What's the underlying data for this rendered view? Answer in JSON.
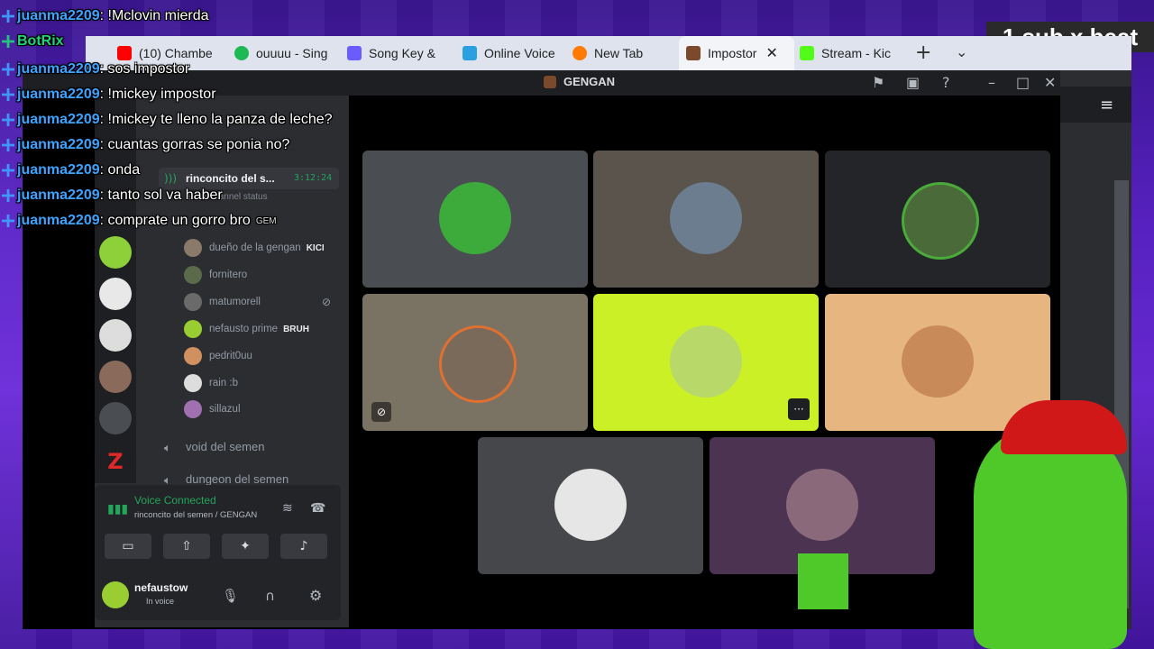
{
  "browser": {
    "tabs": [
      {
        "label": "(10) Chambe",
        "icon": "youtube-icon",
        "color": "#ff0000"
      },
      {
        "label": "ouuuu - Sing",
        "icon": "spotify-icon",
        "color": "#1db954"
      },
      {
        "label": "Song Key &",
        "icon": "tunebat-icon",
        "color": "#6b5cff"
      },
      {
        "label": "Online Voice",
        "icon": "voice-icon",
        "color": "#2aa0e0"
      },
      {
        "label": "New Tab",
        "icon": "firefox-icon",
        "color": "#ff7a00"
      },
      {
        "label": "Impostor",
        "icon": "impostor-icon",
        "color": "#7a4a2a"
      },
      {
        "label": "Stream - Kic",
        "icon": "kick-icon",
        "color": "#53fc18"
      }
    ],
    "new_tab": "+",
    "tab_menu": "⌄",
    "close": "✕"
  },
  "discord": {
    "window_title": "GENGAN",
    "voice_channel": {
      "name": "rinconcito del s...",
      "timer": "3:12:24",
      "status": "Set a channel status"
    },
    "members": [
      {
        "name": "dueño de la gengan",
        "badge": "KICI",
        "color": "#8a7a6a"
      },
      {
        "name": "fornitero",
        "badge": "",
        "color": "#5a6a4a"
      },
      {
        "name": "matumorell",
        "badge": "",
        "color": "#6a6a6a"
      },
      {
        "name": "nefausto prime",
        "badge": "BRUH",
        "color": "#9acd32"
      },
      {
        "name": "pedrit0uu",
        "badge": "",
        "color": "#d09060"
      },
      {
        "name": "rain :b",
        "badge": "",
        "color": "#dddddd"
      },
      {
        "name": "sillazul",
        "badge": "",
        "color": "#a070b0"
      }
    ],
    "channels": [
      {
        "name": "void del semen"
      },
      {
        "name": "dungeon del semen"
      }
    ],
    "voice_panel": {
      "status": "Voice Connected",
      "location": "rinconcito del semen / GENGAN"
    },
    "user": {
      "name": "nefaustow",
      "status": "In voice"
    },
    "tiles": [
      {
        "bg": "#4a4d52",
        "avatar": "#3cab3c"
      },
      {
        "bg": "#5a544d",
        "avatar": "#6b7d8e"
      },
      {
        "bg": "#232528",
        "avatar": "#4aaa3a"
      },
      {
        "bg": "#7a7364",
        "avatar": "#7a6a5a"
      },
      {
        "bg": "#cbf025",
        "avatar": "#b8d96a"
      },
      {
        "bg": "#e7b680",
        "avatar": "#c98a5a"
      },
      {
        "bg": "#46474a",
        "avatar": "#e6e6e6"
      },
      {
        "bg": "#4d3352",
        "avatar": "#8a6a7a"
      }
    ]
  },
  "chat": [
    {
      "name": "juanma2209",
      "text": ": !Mclovin mierda"
    },
    {
      "name": "BotRix",
      "text": ""
    },
    {
      "name": "juanma2209",
      "text": ": sos impostor"
    },
    {
      "name": "juanma2209",
      "text": ": !mickey impostor"
    },
    {
      "name": "juanma2209",
      "text": ": !mickey te lleno la panza de leche?"
    },
    {
      "name": "juanma2209",
      "text": ": cuantas gorras se ponia no?"
    },
    {
      "name": "juanma2209",
      "text": ": onda"
    },
    {
      "name": "juanma2209",
      "text": ": tanto sol va haber"
    },
    {
      "name": "juanma2209",
      "text": ": comprate un gorro bro"
    }
  ],
  "overlay": {
    "sub_text": "1 sub x beat",
    "sub_badge": "GEM"
  }
}
